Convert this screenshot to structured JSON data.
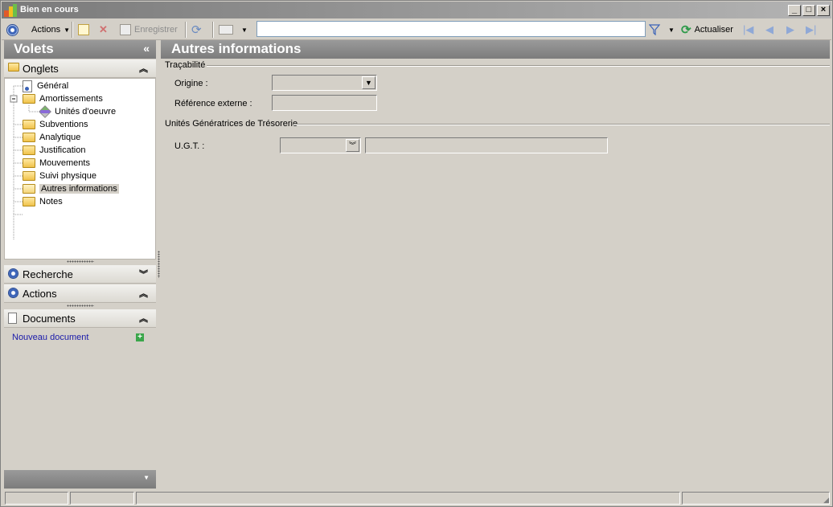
{
  "window": {
    "title": "Bien en cours",
    "controls": {
      "minimize": "_",
      "maximize": "□",
      "close": "×"
    }
  },
  "toolbar": {
    "actions_label": "Actions",
    "save_label": "Enregistrer",
    "search": {
      "value": "",
      "placeholder": ""
    },
    "refresh_label": "Actualiser",
    "nav": {
      "first": "|◀",
      "prev": "◀",
      "next": "▶",
      "last": "▶|"
    }
  },
  "left_pane": {
    "header": "Volets",
    "collapse_glyph": "«",
    "onglets": {
      "title": "Onglets",
      "items": [
        {
          "label": "Général",
          "icon": "document-icon"
        },
        {
          "label": "Amortissements",
          "icon": "folder-icon",
          "expanded": true
        },
        {
          "label": "Unités d'oeuvre",
          "icon": "brush-icon"
        },
        {
          "label": "Subventions",
          "icon": "folder-icon"
        },
        {
          "label": "Analytique",
          "icon": "folder-icon"
        },
        {
          "label": "Justification",
          "icon": "folder-icon"
        },
        {
          "label": "Mouvements",
          "icon": "folder-icon"
        },
        {
          "label": "Suivi physique",
          "icon": "folder-icon"
        },
        {
          "label": "Autres informations",
          "icon": "open-folder-icon",
          "selected": true
        },
        {
          "label": "Notes",
          "icon": "folder-icon"
        }
      ]
    },
    "recherche": {
      "title": "Recherche"
    },
    "actions": {
      "title": "Actions"
    },
    "documents": {
      "title": "Documents",
      "new_document": "Nouveau document"
    }
  },
  "main": {
    "header": "Autres informations",
    "tracabilite": {
      "title": "Traçabilité",
      "origine_label": "Origine :",
      "origine_value": "",
      "reference_label": "Référence externe :",
      "reference_value": ""
    },
    "ugt_group": {
      "title": "Unités Génératrices de Trésorerie",
      "ugt_label": "U.G.T. :",
      "ugt_value": "",
      "ugt_description": ""
    }
  },
  "colors": {
    "window_bg": "#d4d0c8",
    "header_gray": "#8a8a8a",
    "link_blue": "#1a1aaa"
  }
}
